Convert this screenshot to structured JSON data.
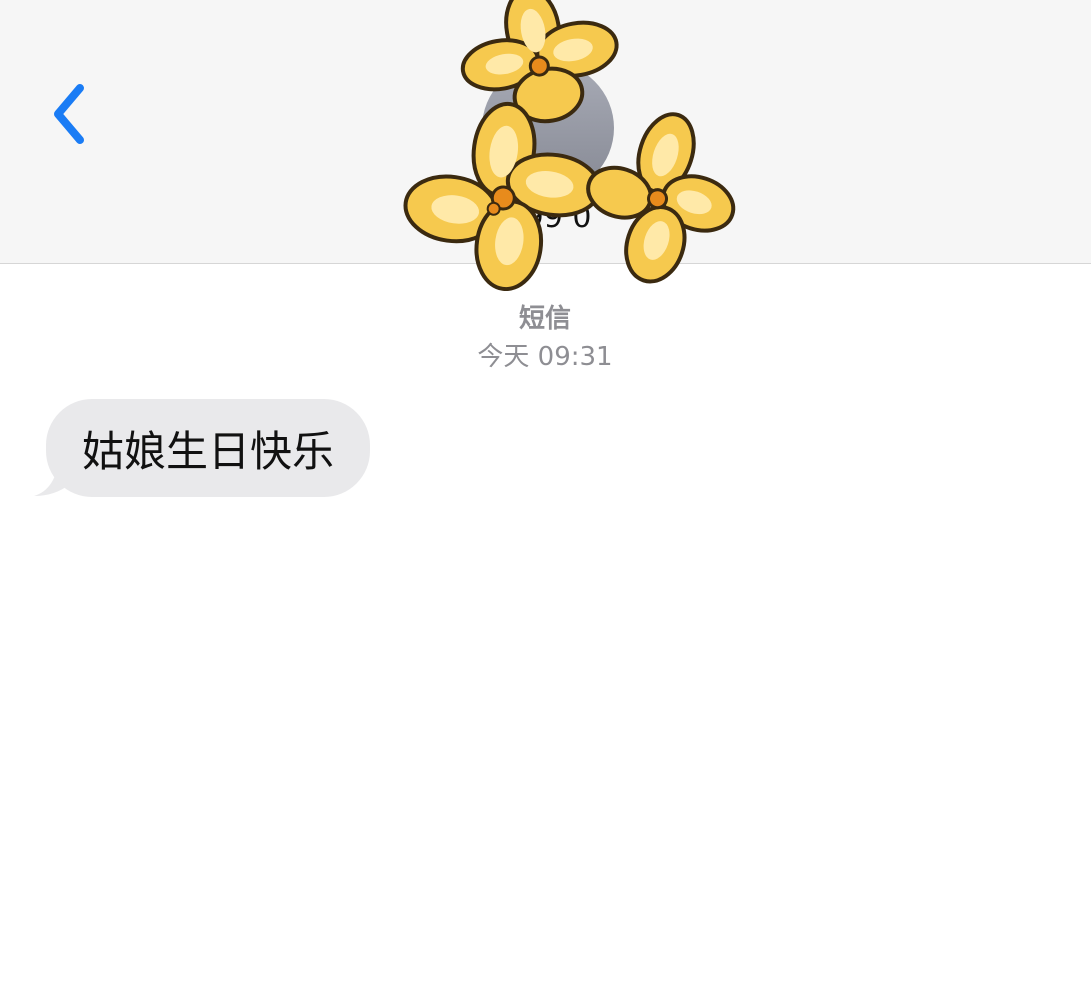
{
  "header": {
    "contact_number": "+99 0"
  },
  "conversation": {
    "service_label": "短信",
    "time_label": "今天 09:31",
    "messages": [
      {
        "direction": "incoming",
        "text": "姑娘生日快乐"
      }
    ]
  },
  "colors": {
    "accent": "#1a7cf5",
    "header_bg": "#f6f6f6",
    "bubble_incoming": "#e9e9eb",
    "meta_text": "#8e8e93",
    "flower_petal": "#f6c94e",
    "flower_outline": "#3b2a10"
  },
  "icons": {
    "back": "chevron-left-icon",
    "sticker": "flowers-sticker"
  }
}
